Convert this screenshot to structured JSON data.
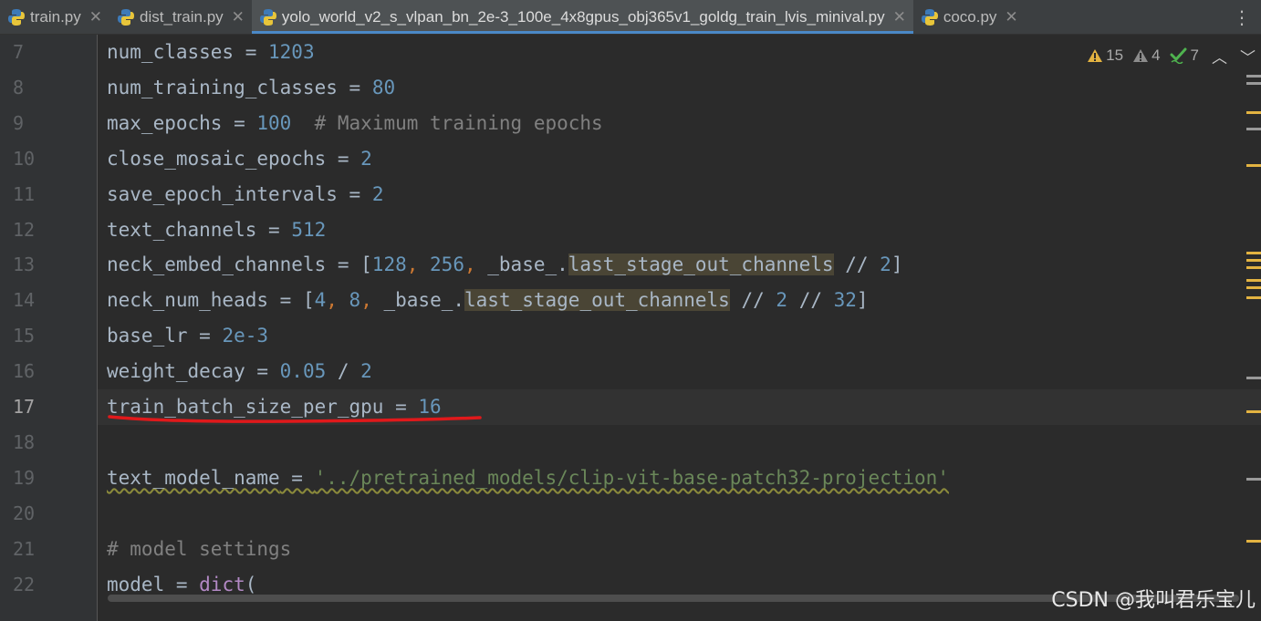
{
  "tabs": [
    {
      "label": "train.py",
      "active": false
    },
    {
      "label": "dist_train.py",
      "active": false
    },
    {
      "label": "yolo_world_v2_s_vlpan_bn_2e-3_100e_4x8gpus_obj365v1_goldg_train_lvis_minival.py",
      "active": true
    },
    {
      "label": "coco.py",
      "active": false
    }
  ],
  "inspections": {
    "warnings": "15",
    "weak_warnings": "4",
    "typos": "7"
  },
  "line_numbers": [
    "7",
    "8",
    "9",
    "10",
    "11",
    "12",
    "13",
    "14",
    "15",
    "16",
    "17",
    "18",
    "19",
    "20",
    "21",
    "22"
  ],
  "current_line": "17",
  "code": {
    "l7": {
      "var": "num_classes",
      "op": " = ",
      "val": "1203"
    },
    "l8": {
      "var": "num_training_classes",
      "op": " = ",
      "val": "80"
    },
    "l9": {
      "var": "max_epochs",
      "op": " = ",
      "val": "100",
      "comment": "  # Maximum training epochs"
    },
    "l10": {
      "var": "close_mosaic_epochs",
      "op": " = ",
      "val": "2"
    },
    "l11": {
      "var": "save_epoch_intervals",
      "op": " = ",
      "val": "2"
    },
    "l12": {
      "var": "text_channels",
      "op": " = ",
      "val": "512"
    },
    "l13": {
      "var": "neck_embed_channels",
      "op": " = [",
      "n1": "128",
      "sep1": ", ",
      "n2": "256",
      "sep2": ", ",
      "base": "_base_.",
      "attr": "last_stage_out_channels",
      "div": " // ",
      "n3": "2",
      "end": "]"
    },
    "l14": {
      "var": "neck_num_heads",
      "op": " = [",
      "n1": "4",
      "sep1": ", ",
      "n2": "8",
      "sep2": ", ",
      "base": "_base_.",
      "attr": "last_stage_out_channels",
      "div": " // ",
      "n3": "2",
      "div2": " // ",
      "n4": "32",
      "end": "]"
    },
    "l15": {
      "var": "base_lr",
      "op": " = ",
      "val": "2e-3"
    },
    "l16": {
      "var": "weight_decay",
      "op": " = ",
      "val": "0.05",
      "div": " / ",
      "val2": "2"
    },
    "l17": {
      "var": "train_batch_size_per_gpu",
      "op": " = ",
      "val": "16"
    },
    "l19": {
      "var": "text_model_name",
      "op": " = ",
      "str": "'../pretrained_models/clip-vit-base-patch32-projection'"
    },
    "l21": {
      "comment": "# model settings"
    },
    "l22": {
      "var": "model",
      "op": " = ",
      "fn": "dict",
      "paren": "("
    }
  },
  "watermark": "CSDN @我叫君乐宝儿",
  "colors": {
    "background": "#2b2b2b",
    "number": "#6897bb",
    "string": "#6a8759",
    "comment": "#808080",
    "warning": "#e3b341",
    "tab_accent": "#4a88c7",
    "annotation_red": "#e0191b"
  }
}
